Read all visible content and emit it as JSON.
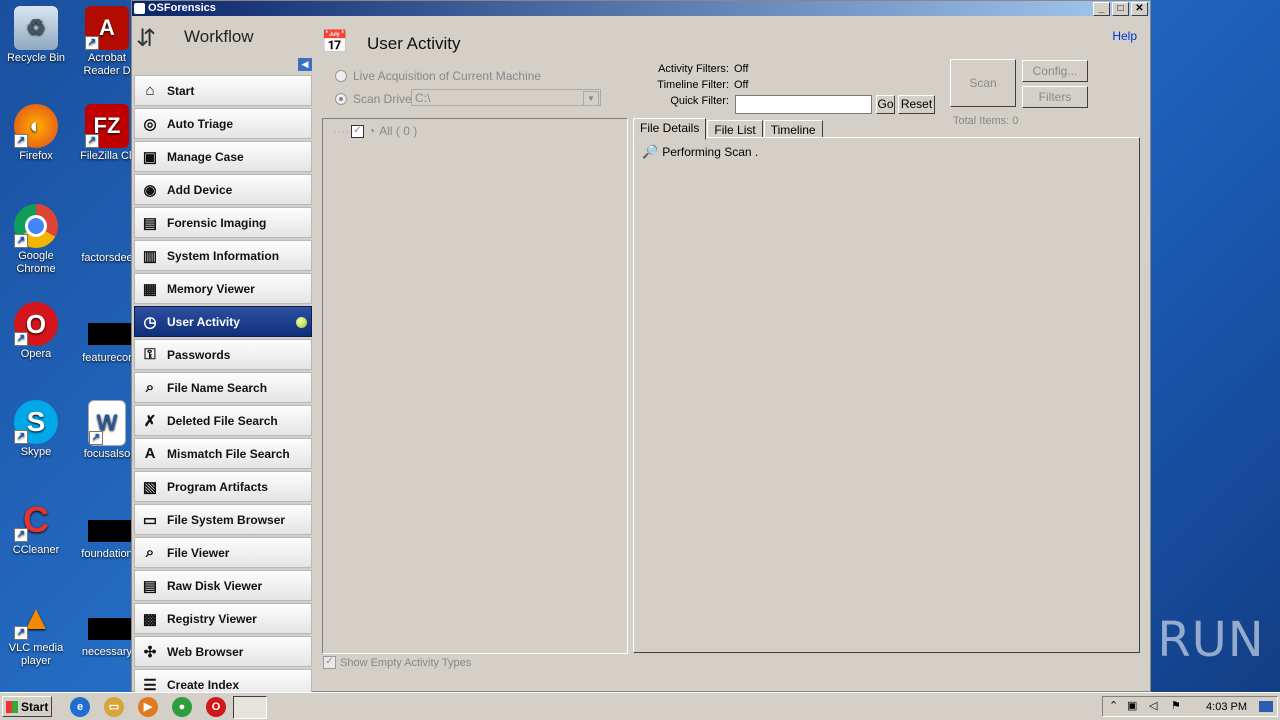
{
  "desktop": {
    "icons_left": [
      {
        "label": "Recycle Bin",
        "icon": "recycle-bin-icon"
      },
      {
        "label": "Firefox",
        "icon": "firefox-icon"
      },
      {
        "label": "Google Chrome",
        "icon": "chrome-icon"
      },
      {
        "label": "Opera",
        "icon": "opera-icon"
      },
      {
        "label": "Skype",
        "icon": "skype-icon"
      },
      {
        "label": "CCleaner",
        "icon": "ccleaner-icon"
      },
      {
        "label": "VLC media player",
        "icon": "vlc-icon"
      }
    ],
    "icons_right": [
      {
        "label": "Acrobat Reader D",
        "icon": "acrobat-icon"
      },
      {
        "label": "FileZilla Cli",
        "icon": "filezilla-icon"
      },
      {
        "label": "factorsdee",
        "icon": "blank-icon"
      },
      {
        "label": "featurecor",
        "icon": "black-file-icon"
      },
      {
        "label": "focusalso",
        "icon": "word-doc-icon"
      },
      {
        "label": "foundation",
        "icon": "black-file-icon"
      },
      {
        "label": "necessary",
        "icon": "black-file-icon"
      }
    ],
    "watermark": "ANY RUN"
  },
  "window": {
    "title": "OSForensics",
    "buttons": [
      "_",
      "□",
      "✕"
    ]
  },
  "sidebar": {
    "title": "Workflow",
    "items": [
      {
        "label": "Start",
        "icon": "start-icon",
        "glyph": "⌂"
      },
      {
        "label": "Auto Triage",
        "icon": "fingerprint-icon",
        "glyph": "◎"
      },
      {
        "label": "Manage Case",
        "icon": "briefcase-icon",
        "glyph": "▣"
      },
      {
        "label": "Add Device",
        "icon": "disc-icon",
        "glyph": "◉"
      },
      {
        "label": "Forensic Imaging",
        "icon": "drive-icon",
        "glyph": "▤"
      },
      {
        "label": "System Information",
        "icon": "computer-icon",
        "glyph": "▥"
      },
      {
        "label": "Memory Viewer",
        "icon": "memory-icon",
        "glyph": "▦"
      },
      {
        "label": "User Activity",
        "icon": "calendar-clock-icon",
        "glyph": "◷",
        "active": true
      },
      {
        "label": "Passwords",
        "icon": "key-icon",
        "glyph": "⚿"
      },
      {
        "label": "File Name Search",
        "icon": "binoculars-icon",
        "glyph": "⌕"
      },
      {
        "label": "Deleted File Search",
        "icon": "deleted-file-icon",
        "glyph": "✗"
      },
      {
        "label": "Mismatch File Search",
        "icon": "abc-icon",
        "glyph": "A"
      },
      {
        "label": "Program Artifacts",
        "icon": "program-icon",
        "glyph": "▧"
      },
      {
        "label": "File System Browser",
        "icon": "folder-icon",
        "glyph": "▭"
      },
      {
        "label": "File Viewer",
        "icon": "magnifier-file-icon",
        "glyph": "⌕"
      },
      {
        "label": "Raw Disk Viewer",
        "icon": "hard-disk-icon",
        "glyph": "▤"
      },
      {
        "label": "Registry Viewer",
        "icon": "registry-icon",
        "glyph": "▩"
      },
      {
        "label": "Web Browser",
        "icon": "web-icon",
        "glyph": "✣"
      },
      {
        "label": "Create Index",
        "icon": "index-icon",
        "glyph": "☰"
      }
    ]
  },
  "main": {
    "title": "User Activity",
    "help": "Help",
    "source": {
      "live_label": "Live Acquisition of Current Machine",
      "scan_drive_label": "Scan Drive:",
      "drive_value": "C:\\"
    },
    "filters": {
      "activity_label": "Activity Filters:",
      "activity_value": "Off",
      "timeline_label": "Timeline Filter:",
      "timeline_value": "Off",
      "quick_label": "Quick Filter:",
      "quick_value": "",
      "go": "Go",
      "reset": "Reset"
    },
    "buttons": {
      "scan": "Scan",
      "config": "Config...",
      "filters": "Filters"
    },
    "total_items": "Total Items: 0",
    "tree_root": "All ( 0 )",
    "show_empty": "Show Empty Activity Types",
    "tabs": [
      "File Details",
      "File List",
      "Timeline"
    ],
    "status": "Performing Scan ."
  },
  "taskbar": {
    "start": "Start",
    "clock": "4:03 PM",
    "quick_launch": [
      {
        "icon": "ie-icon",
        "glyph": "e",
        "color": "#1e6fd0"
      },
      {
        "icon": "explorer-icon",
        "glyph": "▭",
        "color": "#d8a53a"
      },
      {
        "icon": "media-player-icon",
        "glyph": "▶",
        "color": "#e07b1d"
      },
      {
        "icon": "chrome-icon",
        "glyph": "●",
        "color": "#2c9e3d"
      },
      {
        "icon": "opera-icon",
        "glyph": "O",
        "color": "#d01818"
      }
    ]
  }
}
